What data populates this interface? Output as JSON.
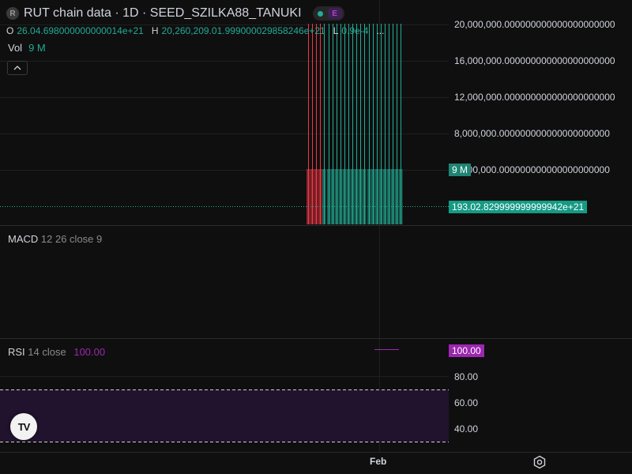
{
  "header": {
    "logo_letter": "R",
    "title": "RUT chain data · 1D · SEED_SZILKA88_TANUKI",
    "badge": "E"
  },
  "ohlc": {
    "o_key": "O",
    "o_val": "26.04.698000000000014e+21",
    "h_key": "H",
    "h_val": "20,260,209.01.999000029858246e+21",
    "l_key": "L",
    "l_val": "0.9e-4",
    "more": "..."
  },
  "volume": {
    "label": "Vol",
    "value": "9 M"
  },
  "price_axis": [
    "20,000,000.000000000000000000000",
    "16,000,000.000000000000000000000",
    "12,000,000.000000000000000000000",
    "8,000,000.000000000000000000000",
    "0,000,000.000000000000000000000"
  ],
  "vol_tag": "9 M",
  "last_price_tag": "193.02.829999999999942e+21",
  "macd": {
    "name": "MACD",
    "params": "12 26 close 9"
  },
  "rsi": {
    "name": "RSI",
    "params": "14 close",
    "value": "100.00",
    "tag": "100.00",
    "axis": [
      "80.00",
      "60.00",
      "40.00"
    ]
  },
  "time_axis": {
    "month": "Feb"
  },
  "colors": {
    "up": "#22ab94",
    "down": "#f23645",
    "rsi": "#9c27b0",
    "bg": "#0f0f0f"
  },
  "icons": {
    "settings": "gear-icon",
    "collapse": "chevron-up-icon",
    "brand": "tradingview-logo"
  }
}
